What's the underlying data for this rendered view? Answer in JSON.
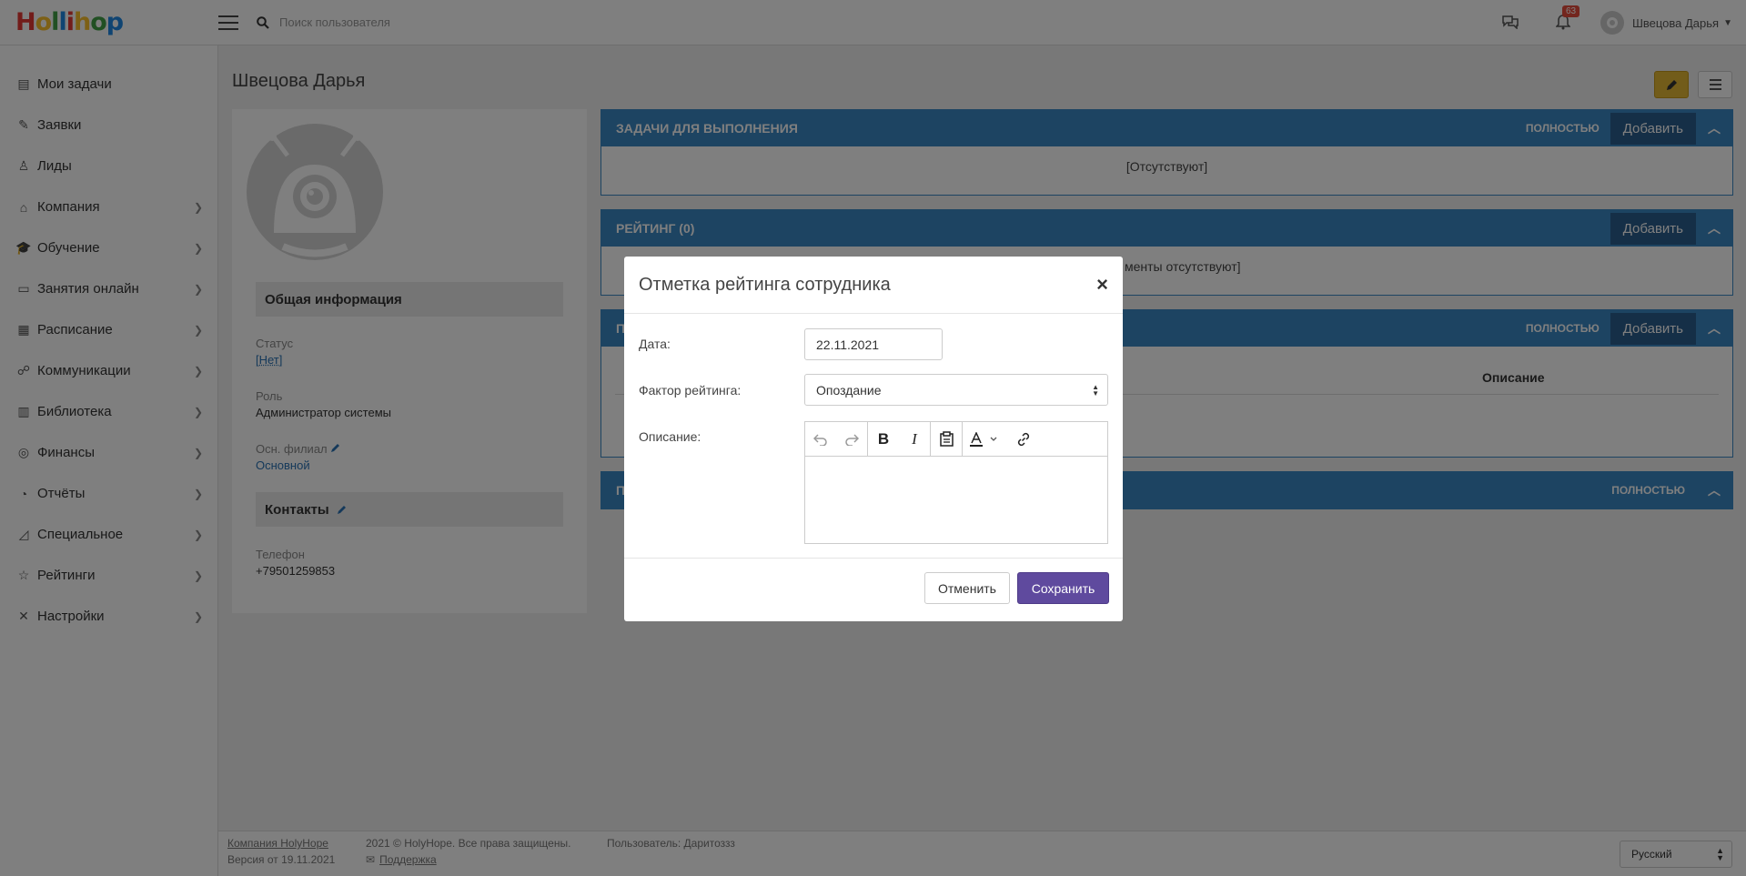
{
  "app": {
    "logo_letters": [
      "H",
      "o",
      "l",
      "l",
      "i",
      "h",
      "o",
      "p"
    ],
    "logo_colors": [
      "#e53935",
      "#fbc02d",
      "#43a047",
      "#1e88e5",
      "#e53935",
      "#fbc02d",
      "#43a047",
      "#1e88e5"
    ]
  },
  "topbar": {
    "search_placeholder": "Поиск пользователя",
    "notifications_count": "63",
    "user_name": "Швецова Дарья"
  },
  "sidebar": {
    "items": [
      {
        "label": "Мои задачи",
        "icon": "list-icon",
        "glyph": "▤",
        "has_arrow": false
      },
      {
        "label": "Заявки",
        "icon": "request-icon",
        "glyph": "✎",
        "has_arrow": false
      },
      {
        "label": "Лиды",
        "icon": "user-icon",
        "glyph": "♙",
        "has_arrow": false
      },
      {
        "label": "Компания",
        "icon": "home-icon",
        "glyph": "⌂",
        "has_arrow": true
      },
      {
        "label": "Обучение",
        "icon": "graduation-cap-icon",
        "glyph": "🎓",
        "has_arrow": true
      },
      {
        "label": "Занятия онлайн",
        "icon": "monitor-icon",
        "glyph": "▭",
        "has_arrow": true
      },
      {
        "label": "Расписание",
        "icon": "calendar-icon",
        "glyph": "▦",
        "has_arrow": true
      },
      {
        "label": "Коммуникации",
        "icon": "users-icon",
        "glyph": "☍",
        "has_arrow": true
      },
      {
        "label": "Библиотека",
        "icon": "book-icon",
        "glyph": "▥",
        "has_arrow": true
      },
      {
        "label": "Финансы",
        "icon": "coins-icon",
        "glyph": "◎",
        "has_arrow": true
      },
      {
        "label": "Отчёты",
        "icon": "pie-chart-icon",
        "glyph": "◔",
        "has_arrow": true
      },
      {
        "label": "Специальное",
        "icon": "area-chart-icon",
        "glyph": "◿",
        "has_arrow": true
      },
      {
        "label": "Рейтинги",
        "icon": "star-icon",
        "glyph": "☆",
        "has_arrow": true
      },
      {
        "label": "Настройки",
        "icon": "tools-icon",
        "glyph": "✕",
        "has_arrow": true
      }
    ]
  },
  "page": {
    "title": "Швецова Дарья"
  },
  "profile": {
    "general_header": "Общая информация",
    "status_label": "Статус",
    "status_value": "[Нет]",
    "role_label": "Роль",
    "role_value": "Администратор системы",
    "branch_label": "Осн. филиал",
    "branch_value": "Основной",
    "contacts_header": "Контакты",
    "phone_label": "Телефон",
    "phone_value": "+79501259853"
  },
  "panels": {
    "tasks": {
      "title": "Задачи для выполнения",
      "full": "ПОЛНОСТЬЮ",
      "add": "Добавить",
      "empty": "[Отсутствуют]"
    },
    "rating": {
      "title": "Рейтинг (0)",
      "add": "Добавить",
      "empty_partial": "менты отсутствуют]"
    },
    "third": {
      "title_partial": "П",
      "full": "ПОЛНОСТЬЮ",
      "add": "Добавить",
      "col_description": "Описание"
    },
    "fourth": {
      "title_partial": "П",
      "full": "ПОЛНОСТЬЮ"
    }
  },
  "footer": {
    "company_link": "Компания HolyHope",
    "version": "Версия от 19.11.2021",
    "copyright": "2021 © HolyHope. Все права защищены.",
    "support": "Поддержка",
    "user": "Пользователь: Даритоззз",
    "language": "Русский"
  },
  "modal": {
    "title": "Отметка рейтинга сотрудника",
    "date_label": "Дата:",
    "date_value": "22.11.2021",
    "factor_label": "Фактор рейтинга:",
    "factor_value": "Опоздание",
    "description_label": "Описание:",
    "cancel": "Отменить",
    "save": "Сохранить"
  }
}
